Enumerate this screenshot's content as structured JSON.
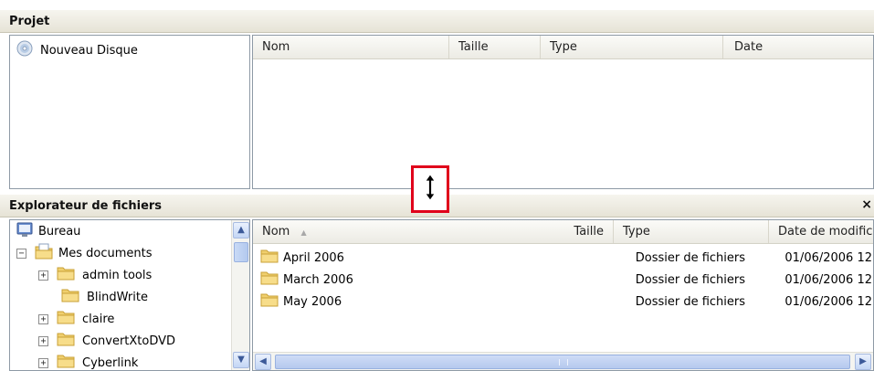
{
  "project": {
    "title": "Projet",
    "tree": [
      {
        "label": "Nouveau Disque",
        "icon": "disc-icon"
      }
    ],
    "columns": [
      "Nom",
      "Taille",
      "Type",
      "Date"
    ]
  },
  "explorer": {
    "title": "Explorateur de fichiers",
    "close_glyph": "×",
    "tree": [
      {
        "label": "Bureau",
        "icon": "desktop-icon",
        "expander": ""
      },
      {
        "label": "Mes documents",
        "icon": "documents-folder-icon",
        "expander": "−"
      },
      {
        "label": "admin tools",
        "icon": "folder-icon",
        "expander": "+"
      },
      {
        "label": "BlindWrite",
        "icon": "folder-icon",
        "expander": ""
      },
      {
        "label": "claire",
        "icon": "folder-icon",
        "expander": "+"
      },
      {
        "label": "ConvertXtoDVD",
        "icon": "folder-icon",
        "expander": "+"
      },
      {
        "label": "Cyberlink",
        "icon": "folder-icon",
        "expander": "+"
      }
    ],
    "columns": [
      "Nom",
      "Taille",
      "Type",
      "Date de modific"
    ],
    "sort_glyph": "▲",
    "files": [
      {
        "name": "April 2006",
        "type": "Dossier de fichiers",
        "date": "01/06/2006 12"
      },
      {
        "name": "March 2006",
        "type": "Dossier de fichiers",
        "date": "01/06/2006 12"
      },
      {
        "name": "May 2006",
        "type": "Dossier de fichiers",
        "date": "01/06/2006 12"
      }
    ]
  },
  "colors": {
    "highlight": "#e0001b",
    "folder": "#f5d67b"
  }
}
